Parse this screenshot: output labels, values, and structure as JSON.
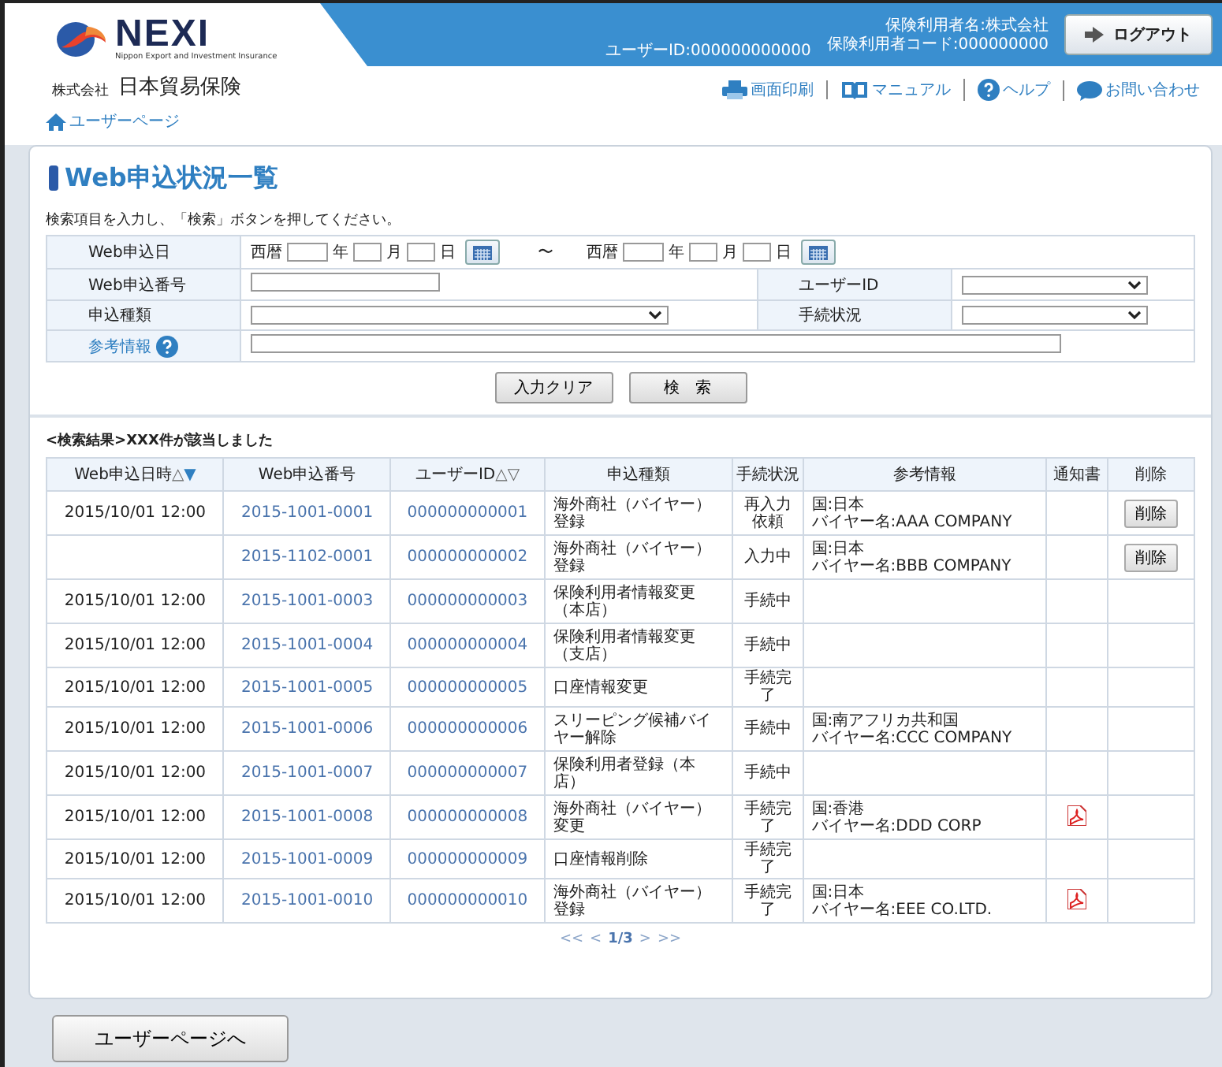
{
  "header": {
    "logo_text": "NEXI",
    "logo_tagline": "Nippon Export and Investment Insurance",
    "company_prefix": "株式会社",
    "company_name": "日本貿易保険",
    "user_id": "ユーザーID:000000000000",
    "user_name": "保険利用者名:株式会社",
    "user_code": "保険利用者コード:000000000",
    "logout": "ログアウト",
    "links": [
      {
        "kind": "print",
        "label": "画面印刷"
      },
      {
        "kind": "manual",
        "label": "マニュアル"
      },
      {
        "kind": "help",
        "label": "ヘルプ"
      },
      {
        "kind": "contact",
        "label": "お問い合わせ"
      }
    ],
    "breadcrumb": "ユーザーページ"
  },
  "page_title": "Web申込状況一覧",
  "instructions": "検索項目を入力し、「検索」ボタンを押してください。",
  "search": {
    "date_label": "Web申込日",
    "date_range": [
      {
        "era": "西暦",
        "units": [
          "年",
          "月",
          "日"
        ]
      },
      {
        "era": "西暦",
        "units": [
          "年",
          "月",
          "日"
        ]
      }
    ],
    "range_separator": "〜",
    "number_label": "Web申込番号",
    "user_id_label": "ユーザーID",
    "type_label": "申込種類",
    "status_label": "手続状況",
    "reference_label": "参考情報",
    "buttons": [
      "入力クリア",
      "検　索"
    ]
  },
  "result_message": "<検索結果>XXX件が該当しました",
  "table": {
    "columns": [
      {
        "label": "Web申込日時",
        "sort": [
          {
            "glyph": "△",
            "selected": false
          },
          {
            "glyph": "▼",
            "selected": true
          }
        ]
      },
      {
        "label": "Web申込番号"
      },
      {
        "label": "ユーザーID",
        "sort": [
          {
            "glyph": "△",
            "selected": false
          },
          {
            "glyph": "▽",
            "selected": false
          }
        ]
      },
      {
        "label": "申込種類"
      },
      {
        "label": "手続状況"
      },
      {
        "label": "参考情報"
      },
      {
        "label": "通知書"
      },
      {
        "label": "削除"
      }
    ],
    "rows": [
      {
        "date": "2015/10/01 12:00",
        "number": "2015-1001-0001",
        "user_id": "000000000001",
        "type": "海外商社（バイヤー）登録",
        "status": "再入力依頼",
        "reference": [
          "国:日本",
          "バイヤー名:AAA COMPANY"
        ],
        "notice": false,
        "delete": "削除"
      },
      {
        "number": "2015-1102-0001",
        "user_id": "000000000002",
        "type": "海外商社（バイヤー）登録",
        "status": "入力中",
        "reference": [
          "国:日本",
          "バイヤー名:BBB COMPANY"
        ],
        "notice": false,
        "delete": "削除"
      },
      {
        "date": "2015/10/01 12:00",
        "number": "2015-1001-0003",
        "user_id": "000000000003",
        "type": "保険利用者情報変更（本店）",
        "status": "手続中",
        "notice": false
      },
      {
        "date": "2015/10/01 12:00",
        "number": "2015-1001-0004",
        "user_id": "000000000004",
        "type": "保険利用者情報変更（支店）",
        "status": "手続中",
        "notice": false
      },
      {
        "date": "2015/10/01 12:00",
        "number": "2015-1001-0005",
        "user_id": "000000000005",
        "type": "口座情報変更",
        "status": "手続完了",
        "notice": false
      },
      {
        "date": "2015/10/01 12:00",
        "number": "2015-1001-0006",
        "user_id": "000000000006",
        "type": "スリーピング候補バイヤー解除",
        "status": "手続中",
        "reference": [
          "国:南アフリカ共和国",
          "バイヤー名:CCC COMPANY"
        ],
        "notice": false
      },
      {
        "date": "2015/10/01 12:00",
        "number": "2015-1001-0007",
        "user_id": "000000000007",
        "type": "保険利用者登録（本店）",
        "status": "手続中",
        "notice": false
      },
      {
        "date": "2015/10/01 12:00",
        "number": "2015-1001-0008",
        "user_id": "000000000008",
        "type": "海外商社（バイヤー）変更",
        "status": "手続完了",
        "reference": [
          "国:香港",
          "バイヤー名:DDD CORP"
        ],
        "notice": true
      },
      {
        "date": "2015/10/01 12:00",
        "number": "2015-1001-0009",
        "user_id": "000000000009",
        "type": "口座情報削除",
        "status": "手続完了",
        "notice": false
      },
      {
        "date": "2015/10/01 12:00",
        "number": "2015-1001-0010",
        "user_id": "000000000010",
        "type": "海外商社（バイヤー）登録",
        "status": "手続完了",
        "reference": [
          "国:日本",
          "バイヤー名:EEE CO.LTD."
        ],
        "notice": true
      }
    ]
  },
  "pagination": {
    "first": "<<",
    "prev": "<",
    "page": "1/3",
    "next": ">",
    "last": ">>"
  },
  "back_button": "ユーザーページへ"
}
